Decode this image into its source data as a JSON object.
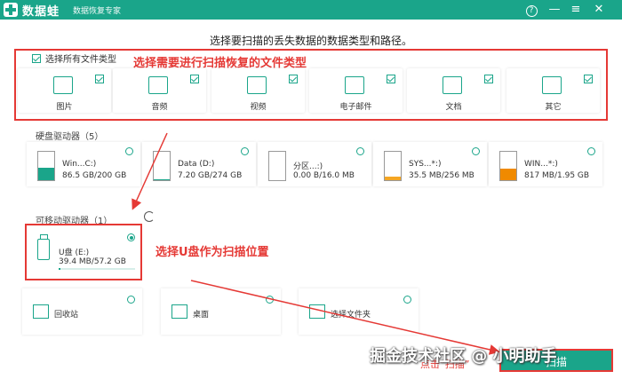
{
  "titlebar": {
    "app_name": "数据蛙",
    "subtitle": "数据恢复专家",
    "help_icon": "?",
    "minimize_icon": "—",
    "menu_icon": "≡",
    "close_icon": "✕"
  },
  "instruction": "选择要扫描的丢失数据的数据类型和路径。",
  "annotations": {
    "file_types": "选择需要进行扫描恢复的文件类型",
    "usb": "选择U盘作为扫描位置",
    "click_scan": "点击“扫描”"
  },
  "file_types": {
    "select_all_label": "选择所有文件类型",
    "items": [
      {
        "label": "图片",
        "icon": "image-icon",
        "checked": true
      },
      {
        "label": "音频",
        "icon": "music-icon",
        "checked": true
      },
      {
        "label": "视频",
        "icon": "video-icon",
        "checked": true
      },
      {
        "label": "电子邮件",
        "icon": "email-icon",
        "checked": true
      },
      {
        "label": "文档",
        "icon": "document-icon",
        "checked": true
      },
      {
        "label": "其它",
        "icon": "other-icon",
        "checked": true
      }
    ]
  },
  "hard_drives": {
    "title": "硬盘驱动器（5）",
    "items": [
      {
        "name": "Win...C:)",
        "size": "86.5 GB/200 GB",
        "fill_fraction": 0.43,
        "color": "#1aa58a"
      },
      {
        "name": "Data (D:)",
        "size": "7.20 GB/274 GB",
        "fill_fraction": 0.03,
        "color": "#1aa58a"
      },
      {
        "name": "分区...:)",
        "size": "0.00  B/16.0 MB",
        "fill_fraction": 0.0,
        "color": "#1aa58a"
      },
      {
        "name": "SYS...*:)",
        "size": "35.5 MB/256 MB",
        "fill_fraction": 0.14,
        "color": "#f5a623"
      },
      {
        "name": "WIN...*:)",
        "size": "817 MB/1.95 GB",
        "fill_fraction": 0.42,
        "color": "#f08a00"
      }
    ]
  },
  "removable": {
    "title": "可移动驱动器（1）",
    "item": {
      "name": "U盘 (E:)",
      "size": "39.4 MB/57.2 GB",
      "fill_fraction": 0.02
    }
  },
  "locations": [
    {
      "label": "回收站",
      "icon": "trash-icon"
    },
    {
      "label": "桌面",
      "icon": "desktop-icon"
    },
    {
      "label": "选择文件夹",
      "icon": "folder-icon"
    }
  ],
  "scan_button": "扫描",
  "watermark": "掘金技术社区 @ 小明助手",
  "colors": {
    "accent": "#1aa58a",
    "annotation": "#e53935"
  }
}
